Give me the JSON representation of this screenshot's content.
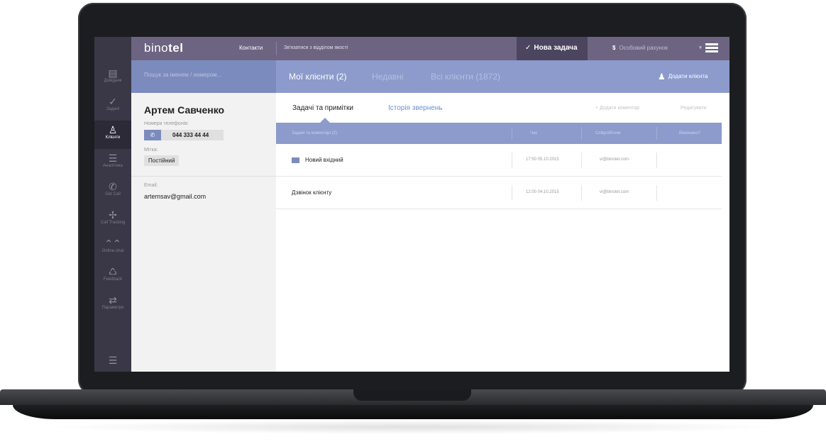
{
  "rail": {
    "items": [
      {
        "icon": "book-icon",
        "glyph": "▤",
        "label": "Довідник"
      },
      {
        "icon": "check-icon",
        "glyph": "✓",
        "label": "Задачі"
      },
      {
        "icon": "person-icon",
        "glyph": "♙",
        "label": "Клієнти"
      },
      {
        "icon": "analytics-icon",
        "glyph": "☰",
        "label": "Аналітика"
      },
      {
        "icon": "phone-icon",
        "glyph": "✆",
        "label": "Get Call"
      },
      {
        "icon": "tracking-icon",
        "glyph": "✢",
        "label": "Call Tracking"
      },
      {
        "icon": "chat-icon",
        "glyph": "⌃⌃",
        "label": "Online-chat"
      },
      {
        "icon": "feedback-icon",
        "glyph": "♺",
        "label": "Feedback"
      },
      {
        "icon": "settings-icon",
        "glyph": "⇄",
        "label": "Параметри"
      }
    ],
    "menu_glyph": "☰"
  },
  "topbar": {
    "logo_plain": "bino",
    "logo_bold": "tel",
    "contacts": "Контакти",
    "quality": "Зв'язатися з відділом якості",
    "new_task": "Нова задача",
    "account": "Особовий рахунок",
    "account_symbol": "$",
    "menu_arrow": "▾"
  },
  "subbar": {
    "search_placeholder": "Пошук за іменем / номером...",
    "tab_mine": "Мої клієнти (2)",
    "tab_recent": "Недавні",
    "tab_all": "Всі клієнти (1872)",
    "add_client": "Додати клієнта"
  },
  "client": {
    "name": "Артем Савченко",
    "phones_label": "Номери телефонів:",
    "phone": "044 333 44 44",
    "tag_label": "Мітка:",
    "tag": "Постійний",
    "email_label": "Email:",
    "email": "artemsav@gmail.com"
  },
  "content": {
    "tab_tasks": "Задачі та примітки",
    "tab_history": "Історія звернень",
    "add_comment": "+ Додати коментар",
    "edit": "Редагувати",
    "headers": {
      "title": "Задачі та коментарі (2)",
      "time": "Час",
      "employee": "Співробітник",
      "done": "Виконано?"
    },
    "rows": [
      {
        "title": "Новий вхідний",
        "time": "17:50 05.10.2015",
        "user": "vi@binotel.com",
        "flag": true
      },
      {
        "title": "Дзвінок клієнту",
        "time": "12:00 04.10.2015",
        "user": "vi@binotel.com",
        "flag": false
      }
    ]
  },
  "colors": {
    "rail": "#3a3846",
    "topbar": "#6d6482",
    "subbar": "#8c9bcb",
    "accent": "#7c8bbd"
  }
}
